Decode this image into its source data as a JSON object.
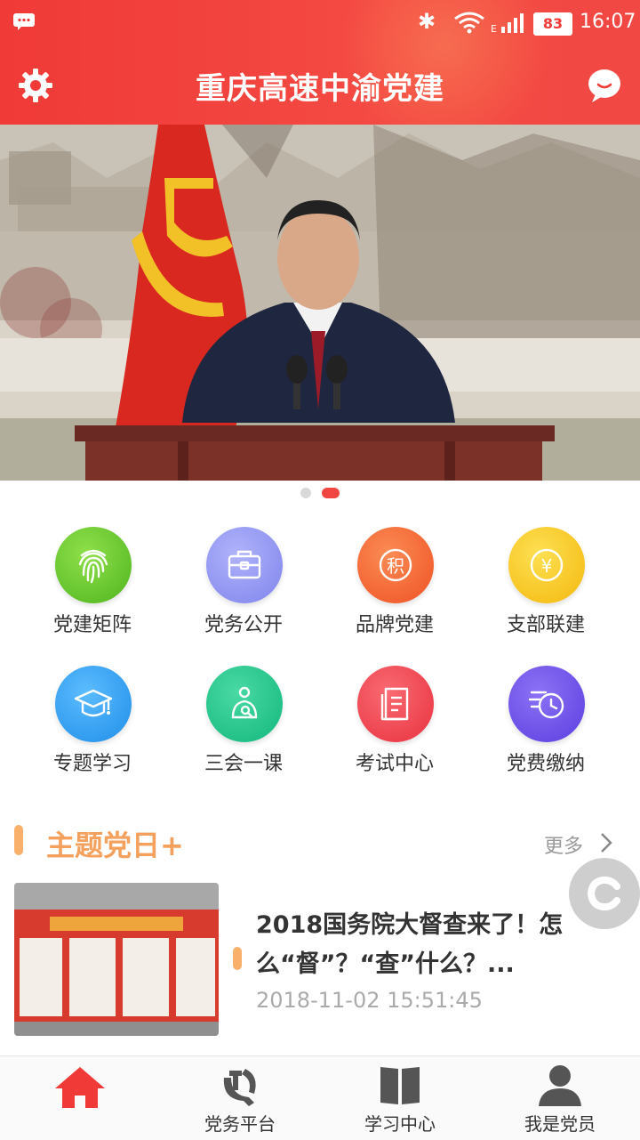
{
  "status_bar": {
    "battery": "83",
    "time": "16:07"
  },
  "header": {
    "title": "重庆高速中渝党建"
  },
  "banner": {
    "slide_count": 2,
    "active_slide": 2
  },
  "grid": [
    {
      "label": "党建矩阵",
      "icon": "fingerprint-icon",
      "color": "#5fc52a"
    },
    {
      "label": "党务公开",
      "icon": "briefcase-icon",
      "color": "#8b8ff0"
    },
    {
      "label": "品牌党建",
      "icon": "points-icon",
      "color": "#f4622f"
    },
    {
      "label": "支部联建",
      "icon": "yuan-icon",
      "color": "#f6c51a"
    },
    {
      "label": "专题学习",
      "icon": "graduation-cap-icon",
      "color": "#2e9ef0"
    },
    {
      "label": "三会一课",
      "icon": "lecture-icon",
      "color": "#1fc48c"
    },
    {
      "label": "考试中心",
      "icon": "exam-icon",
      "color": "#ef3f4d"
    },
    {
      "label": "党费缴纳",
      "icon": "clock-payment-icon",
      "color": "#6a49e6"
    }
  ],
  "section": {
    "title": "主题党日+",
    "more": "更多"
  },
  "news": {
    "headline": "2018国务院大督查来了！怎么“督”？“查”什么？...",
    "date": "2018-11-02 15:51:45"
  },
  "bottom_nav": [
    {
      "label": "",
      "icon": "home-icon",
      "active": true
    },
    {
      "label": "党务平台",
      "icon": "hammer-sickle-icon"
    },
    {
      "label": "学习中心",
      "icon": "book-icon"
    },
    {
      "label": "我是党员",
      "icon": "user-icon"
    }
  ],
  "colors": {
    "primary": "#f03a37",
    "accent": "#f5a05c"
  }
}
